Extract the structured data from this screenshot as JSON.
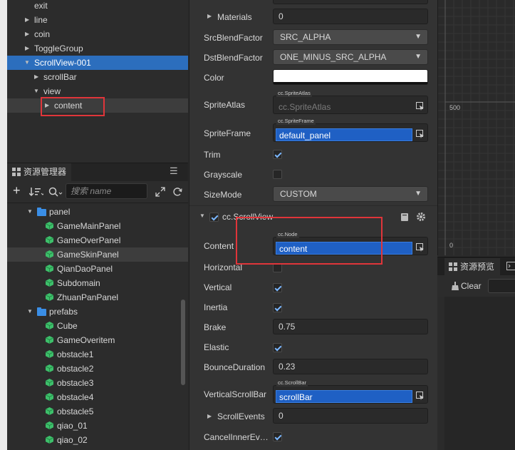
{
  "hierarchy": {
    "items": [
      {
        "label": "exit",
        "indent": 0,
        "arrow": "none"
      },
      {
        "label": "line",
        "indent": 0,
        "arrow": "right"
      },
      {
        "label": "coin",
        "indent": 0,
        "arrow": "right"
      },
      {
        "label": "ToggleGroup",
        "indent": 0,
        "arrow": "right"
      },
      {
        "label": "ScrollView-001",
        "indent": 0,
        "arrow": "down"
      },
      {
        "label": "scrollBar",
        "indent": 1,
        "arrow": "right"
      },
      {
        "label": "view",
        "indent": 1,
        "arrow": "down"
      },
      {
        "label": "content",
        "indent": 2,
        "arrow": "right"
      }
    ]
  },
  "assets": {
    "tab_label": "资源管理器",
    "search_placeholder": "搜索 name",
    "items": [
      {
        "label": "panel",
        "type": "folder"
      },
      {
        "label": "GameMainPanel",
        "type": "prefab"
      },
      {
        "label": "GameOverPanel",
        "type": "prefab"
      },
      {
        "label": "GameSkinPanel",
        "type": "prefab"
      },
      {
        "label": "QianDaoPanel",
        "type": "prefab"
      },
      {
        "label": "Subdomain",
        "type": "prefab"
      },
      {
        "label": "ZhuanPanPanel",
        "type": "prefab"
      },
      {
        "label": "prefabs",
        "type": "folder"
      },
      {
        "label": "Cube",
        "type": "prefab"
      },
      {
        "label": "GameOveritem",
        "type": "prefab"
      },
      {
        "label": "obstacle1",
        "type": "prefab"
      },
      {
        "label": "obstacle2",
        "type": "prefab"
      },
      {
        "label": "obstacle3",
        "type": "prefab"
      },
      {
        "label": "obstacle4",
        "type": "prefab"
      },
      {
        "label": "obstacle5",
        "type": "prefab"
      },
      {
        "label": "qiao_01",
        "type": "prefab"
      },
      {
        "label": "qiao_02",
        "type": "prefab"
      }
    ]
  },
  "inspector": {
    "materials": {
      "label": "Materials",
      "value": "0"
    },
    "src_blend": {
      "label": "SrcBlendFactor",
      "value": "SRC_ALPHA"
    },
    "dst_blend": {
      "label": "DstBlendFactor",
      "value": "ONE_MINUS_SRC_ALPHA"
    },
    "color": {
      "label": "Color",
      "value": "#ffffff"
    },
    "sprite_atlas": {
      "label": "SpriteAtlas",
      "tag": "cc.SpriteAtlas",
      "value": "cc.SpriteAtlas"
    },
    "sprite_frame": {
      "label": "SpriteFrame",
      "tag": "cc.SpriteFrame",
      "value": "default_panel"
    },
    "trim": {
      "label": "Trim",
      "checked": true
    },
    "grayscale": {
      "label": "Grayscale",
      "checked": false
    },
    "size_mode": {
      "label": "SizeMode",
      "value": "CUSTOM"
    },
    "scrollview_title": "cc.ScrollView",
    "content": {
      "label": "Content",
      "tag": "cc.Node",
      "value": "content"
    },
    "horizontal": {
      "label": "Horizontal",
      "checked": false
    },
    "vertical": {
      "label": "Vertical",
      "checked": true
    },
    "inertia": {
      "label": "Inertia",
      "checked": true
    },
    "brake": {
      "label": "Brake",
      "value": "0.75"
    },
    "elastic": {
      "label": "Elastic",
      "checked": true
    },
    "bounce": {
      "label": "BounceDuration",
      "value": "0.23"
    },
    "vscrollbar": {
      "label": "VerticalScrollBar",
      "tag": "cc.ScrollBar",
      "value": "scrollBar"
    },
    "scroll_events": {
      "label": "ScrollEvents",
      "value": "0"
    },
    "cancel_inner": {
      "label": "CancelInnerEv…",
      "checked": true
    }
  },
  "scene": {
    "ruler_500": "500",
    "ruler_0": "0"
  },
  "preview": {
    "tab_label": "资源预览",
    "clear_label": "Clear"
  },
  "colors": {
    "accent": "#2c6ebd",
    "highlight": "#e0353a",
    "field_blue": "#1f60c4"
  }
}
